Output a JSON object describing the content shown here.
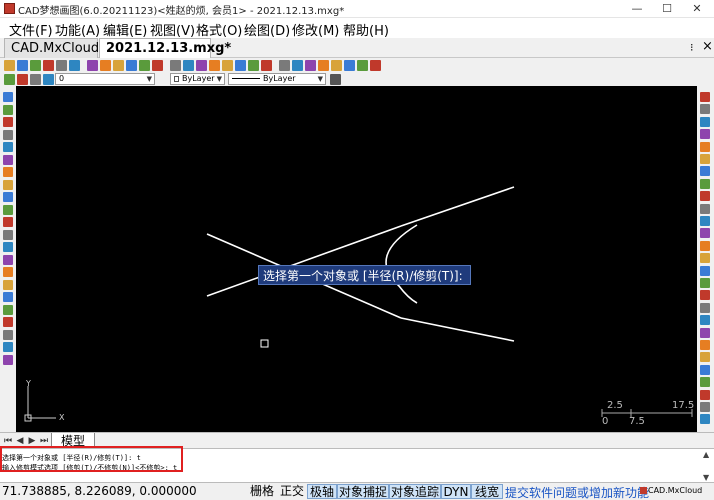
{
  "window": {
    "title": "CAD梦想画图(6.0.20211123)<姓赵的烦, 会员1> - 2021.12.13.mxg*",
    "min_glyph": "—",
    "max_glyph": "☐",
    "close_glyph": "✕"
  },
  "menu": {
    "items": [
      "文件(F)",
      "功能(A)",
      "编辑(E)",
      "视图(V)",
      "格式(O)",
      "绘图(D)",
      "修改(M)",
      "帮助(H)"
    ]
  },
  "tabs": {
    "items": [
      "CAD.MxCloud",
      "2021.12.13.mxg*"
    ],
    "overflow_glyph": "⁝",
    "close_glyph": "×"
  },
  "properties_bar": {
    "layer_value": "0",
    "color_value": "ByLayer",
    "linetype_value": "ByLayer"
  },
  "canvas": {
    "prompt_tip": "选择第一个对象或 [半径(R)/修剪(T)]:",
    "axis_x": "X",
    "axis_y": "Y",
    "scale_top": [
      "2.5",
      "17.5"
    ],
    "scale_bottom": [
      "0",
      "7.5"
    ]
  },
  "layout_tabs": {
    "model_label": "模型"
  },
  "command": {
    "lines": [
      "选择第一个对象或 [半径(R)/修剪(T)]: t",
      "输入修剪模式选项 [修剪(T)/不修剪(N)]<不修剪>: t"
    ]
  },
  "status": {
    "coords": "71.738885,  8.226089,  0.000000",
    "buttons": [
      "栅格",
      "正交",
      "极轴",
      "对象捕捉",
      "对象追踪",
      "DYN",
      "线宽"
    ],
    "active_buttons": [
      "极轴",
      "对象捕捉",
      "对象追踪",
      "DYN",
      "线宽"
    ],
    "feedback_link": "提交软件问题或增加新功能",
    "brand": "CAD.MxCloud"
  },
  "colors": {
    "canvas_bg": "#000000",
    "drawing_lines": "#ffffff",
    "prompt_bg": "#1f3b7c",
    "highlight_border": "#e02020",
    "link": "#1a55c4"
  }
}
